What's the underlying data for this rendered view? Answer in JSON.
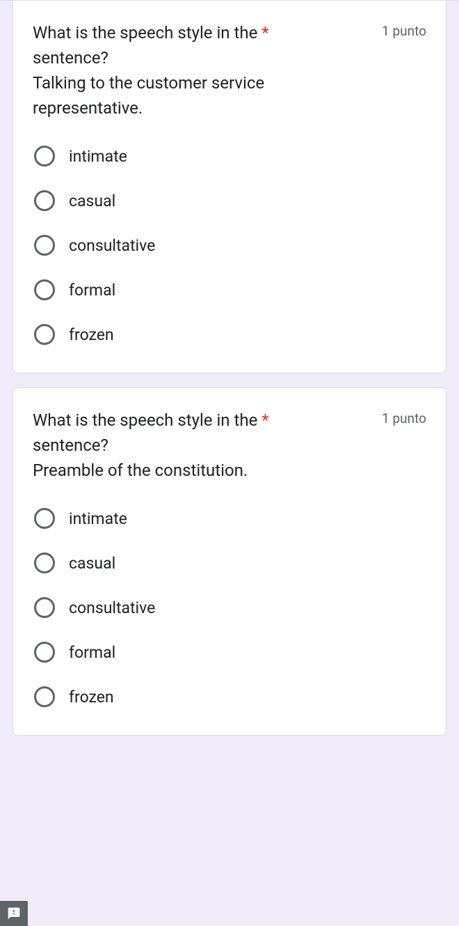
{
  "questions": [
    {
      "text_line1": "What is the speech style in the sentence?",
      "text_line2": "Talking to the customer service representative.",
      "required": "*",
      "points": "1 punto",
      "options": [
        "intimate",
        "casual",
        "consultative",
        "formal",
        "frozen"
      ]
    },
    {
      "text_line1": "What is the speech style in the sentence?",
      "text_line2": "Preamble of the constitution.",
      "required": "*",
      "points": "1 punto",
      "options": [
        "intimate",
        "casual",
        "consultative",
        "formal",
        "frozen"
      ]
    }
  ]
}
